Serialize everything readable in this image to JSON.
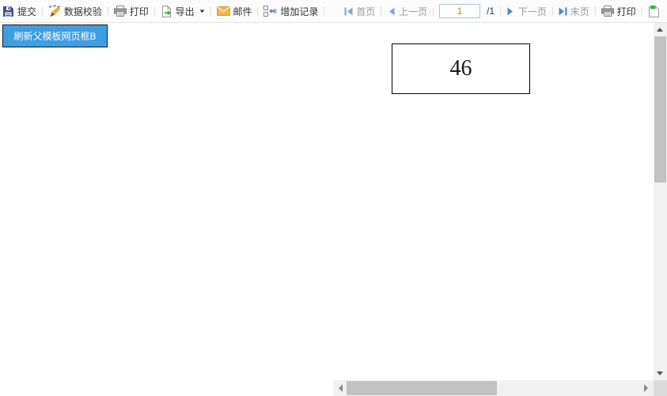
{
  "toolbar": {
    "separator": "|",
    "submit_label": "提交",
    "validate_label": "数据校验",
    "print_label": "打印",
    "export_label": "导出",
    "mail_label": "邮件",
    "add_record_label": "增加记录"
  },
  "pagination": {
    "first_label": "首页",
    "prev_label": "上一页",
    "page_value": "1",
    "total_label": "/1",
    "next_label": "下一页",
    "last_label": "末页",
    "print_label": "打印"
  },
  "content": {
    "refresh_button_label": "刷新父模板网页框B",
    "cell_value": "46"
  },
  "icons": {
    "save": "floppy-disk",
    "validate": "pen-with-check-marks",
    "print": "printer",
    "export": "page-with-green-arrow",
    "export_caret": "chevron-down",
    "mail": "orange-envelope",
    "add_record": "records-with-blue-arrow",
    "first_page": "bar-left-triangle",
    "prev_page": "left-triangle",
    "next_page": "right-triangle",
    "last_page": "right-triangle-bar",
    "partial_right": "page-with-green-corner"
  },
  "colors": {
    "toolbar_bg": "#FBFBFB",
    "refresh_button_bg": "#3D9EE2",
    "nav_arrow_muted": "#85A9CF",
    "nav_arrow_active": "#3E8FE0",
    "page_input_text": "#BE8A00",
    "scrollbar_track": "#F1F1F1",
    "scrollbar_thumb": "#C2C2C2"
  }
}
